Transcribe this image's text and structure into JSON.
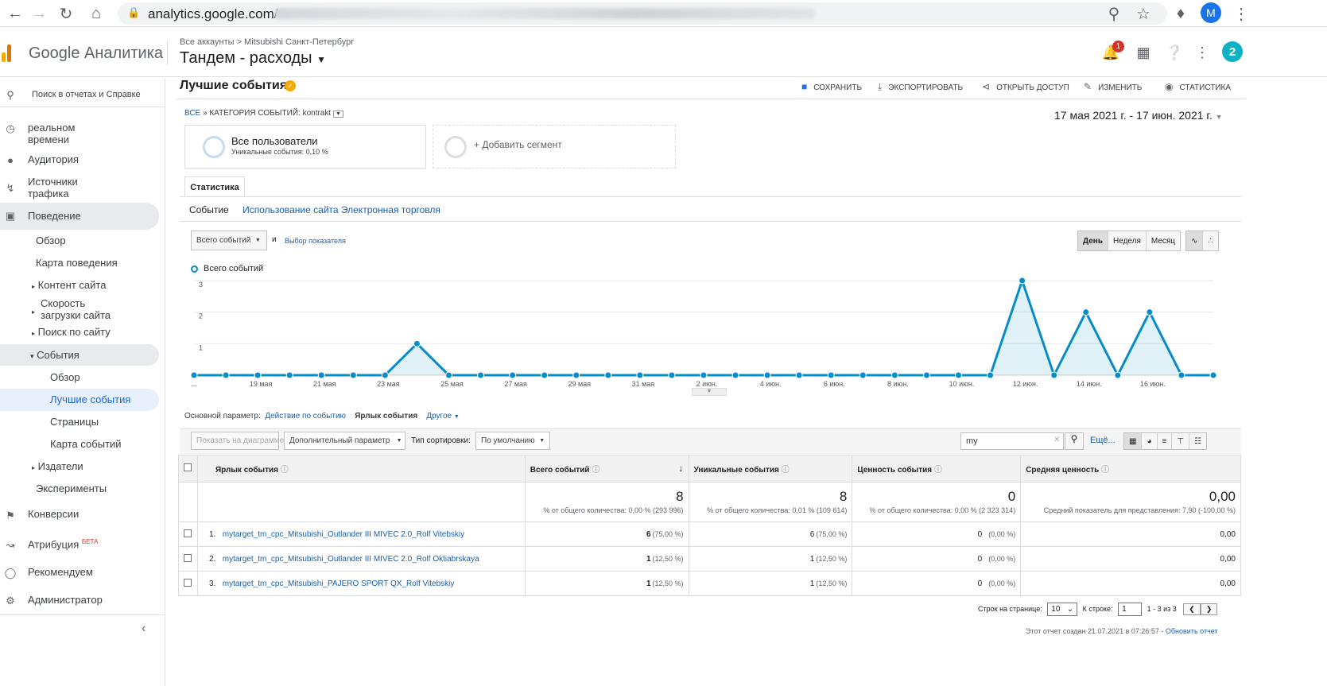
{
  "browser": {
    "url": "analytics.google.com/",
    "profile_initial": "M"
  },
  "header": {
    "brand": "Google Аналитика",
    "breadcrumb": "Все аккаунты > Mitsubishi Санкт-Петербург",
    "view": "Тандем - расходы",
    "notif_count": "1",
    "avatar": "2"
  },
  "sidebar": {
    "search_placeholder": "Поиск в отчетах и Справке",
    "items": [
      {
        "label": "реальном времени"
      },
      {
        "label": "Аудитория"
      },
      {
        "label": "Источники трафика"
      },
      {
        "label": "Поведение"
      },
      {
        "label": "Обзор"
      },
      {
        "label": "Карта поведения"
      },
      {
        "label": "Контент сайта"
      },
      {
        "label": "Скорость загрузки сайта"
      },
      {
        "label": "Поиск по сайту"
      },
      {
        "label": "События"
      },
      {
        "label": "Обзор"
      },
      {
        "label": "Лучшие события"
      },
      {
        "label": "Страницы"
      },
      {
        "label": "Карта событий"
      },
      {
        "label": "Издатели"
      },
      {
        "label": "Эксперименты"
      },
      {
        "label": "Конверсии"
      },
      {
        "label": "Атрибуция"
      },
      {
        "label": "Рекомендуем"
      },
      {
        "label": "Администратор"
      }
    ],
    "beta": "БЕТА"
  },
  "page": {
    "title": "Лучшие события",
    "toolbar": {
      "save": "СОХРАНИТЬ",
      "export": "ЭКСПОРТИРОВАТЬ",
      "share": "ОТКРЫТЬ ДОСТУП",
      "edit": "ИЗМЕНИТЬ",
      "insights": "СТАТИСТИКА"
    },
    "crumb_all": "ВСЕ",
    "crumb_sep": "»",
    "crumb_cat": "КАТЕГОРИЯ СОБЫТИЙ: kontrakt",
    "date_range": "17 мая 2021 г. - 17 июн. 2021 г.",
    "segment": {
      "name": "Все пользователи",
      "sub": "Уникальные события: 0,10 %",
      "add": "+ Добавить сегмент"
    },
    "tab": "Статистика",
    "subtabs": [
      "Событие",
      "Использование сайта",
      "Электронная торговля"
    ],
    "metric_select": "Всего событий",
    "and": "и",
    "choose_metric": "Выбор показателя",
    "period": [
      "День",
      "Неделя",
      "Месяц"
    ],
    "legend": "Всего событий",
    "primary_dim_label": "Основной параметр:",
    "dim_action": "Действие по событию",
    "dim_label": "Ярлык события",
    "dim_other": "Другое",
    "plot_btn": "Показать на диаграмме",
    "secondary": "Дополнительный параметр",
    "sort_label": "Тип сортировки:",
    "sort_value": "По умолчанию",
    "search_value": "my",
    "more": "Ещё..."
  },
  "chart_data": {
    "type": "line",
    "series": [
      {
        "name": "Всего событий",
        "values": [
          0,
          0,
          0,
          0,
          0,
          0,
          0,
          1,
          0,
          0,
          0,
          0,
          0,
          0,
          0,
          0,
          0,
          0,
          0,
          0,
          0,
          0,
          0,
          0,
          0,
          0,
          3,
          0,
          2,
          0,
          2,
          0,
          0
        ]
      }
    ],
    "x_ticks": [
      "...",
      "19 мая",
      "21 мая",
      "23 мая",
      "25 мая",
      "27 мая",
      "29 мая",
      "31 мая",
      "2 июн.",
      "4 июн.",
      "6 июн.",
      "8 июн.",
      "10 июн.",
      "12 июн.",
      "14 июн.",
      "16 июн."
    ],
    "y_ticks": [
      "1",
      "2",
      "3"
    ],
    "ylim": [
      0,
      3
    ],
    "color": "#058dc7"
  },
  "table": {
    "headers": [
      "Ярлык события",
      "Всего событий",
      "Уникальные события",
      "Ценность события",
      "Средняя ценность"
    ],
    "totals": [
      {
        "value": "8",
        "sub": "% от общего количества: 0,00 % (293 996)"
      },
      {
        "value": "8",
        "sub": "% от общего количества: 0,01 % (109 614)"
      },
      {
        "value": "0",
        "sub": "% от общего количества: 0,00 % (2 323 314)"
      },
      {
        "value": "0,00",
        "sub": "Средний показатель для представления: 7,90 (-100,00 %)"
      }
    ],
    "rows": [
      {
        "n": "1.",
        "label": "mytarget_tm_cpc_Mitsubishi_Outlander III MIVEC 2.0_Rolf Vitebskiy",
        "total": "6",
        "total_pct": "(75,00 %)",
        "uniq": "6",
        "uniq_pct": "(75,00 %)",
        "val": "0",
        "val_pct": "(0,00 %)",
        "avg": "0,00"
      },
      {
        "n": "2.",
        "label": "mytarget_tm_cpc_Mitsubishi_Outlander III MIVEC 2.0_Rolf Oktiabrskaya",
        "total": "1",
        "total_pct": "(12,50 %)",
        "uniq": "1",
        "uniq_pct": "(12,50 %)",
        "val": "0",
        "val_pct": "(0,00 %)",
        "avg": "0,00"
      },
      {
        "n": "3.",
        "label": "mytarget_tm_cpc_Mitsubishi_PAJERO SPORT QX_Rolf Vitebskiy",
        "total": "1",
        "total_pct": "(12,50 %)",
        "uniq": "1",
        "uniq_pct": "(12,50 %)",
        "val": "0",
        "val_pct": "(0,00 %)",
        "avg": "0,00"
      }
    ]
  },
  "pager": {
    "rows_label": "Строк на странице:",
    "rows_value": "10",
    "goto_label": "К строке:",
    "goto_value": "1",
    "range": "1 - 3 из 3"
  },
  "footer": {
    "text": "Этот отчет создан 21.07.2021 в 07:26:57 - ",
    "refresh": "Обновить отчет"
  }
}
